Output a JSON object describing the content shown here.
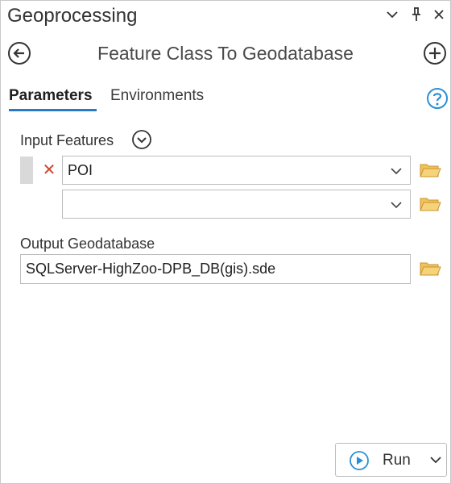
{
  "window": {
    "title": "Geoprocessing",
    "controls": [
      "chevron-down-icon",
      "pin-icon",
      "close-icon"
    ]
  },
  "tool": {
    "title": "Feature Class To Geodatabase",
    "back_icon": "circle-arrow-left-icon",
    "add_icon": "circle-plus-icon"
  },
  "tabs": {
    "parameters": "Parameters",
    "environments": "Environments",
    "active": "Parameters",
    "help_icon": "help-circle-icon"
  },
  "form": {
    "input_features": {
      "label": "Input Features",
      "rows": [
        {
          "value": "POI"
        },
        {
          "value": ""
        }
      ]
    },
    "output_geodatabase": {
      "label": "Output Geodatabase",
      "value": "SQLServer-HighZoo-DPB_DB(gis).sde"
    }
  },
  "run": {
    "label": "Run"
  },
  "colors": {
    "accent": "#2a79c7",
    "remove": "#d0452e",
    "folder": "#e8b64b",
    "run_icon": "#2a8fd6"
  }
}
